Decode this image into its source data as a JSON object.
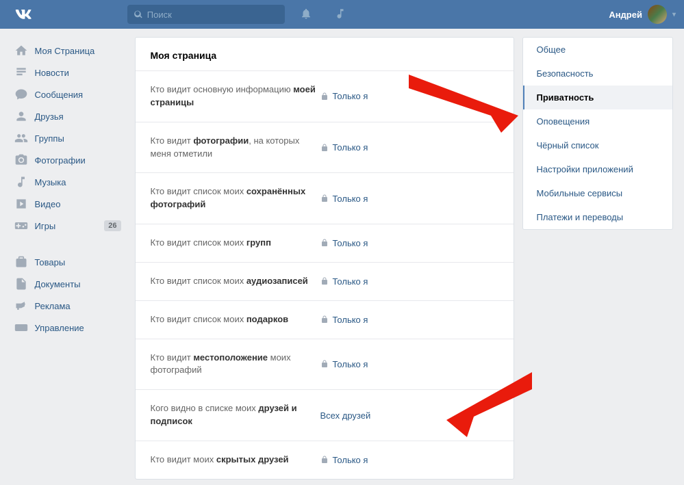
{
  "header": {
    "search_placeholder": "Поиск",
    "user_name": "Андрей"
  },
  "sidebar": {
    "items": [
      {
        "label": "Моя Страница"
      },
      {
        "label": "Новости"
      },
      {
        "label": "Сообщения"
      },
      {
        "label": "Друзья"
      },
      {
        "label": "Группы"
      },
      {
        "label": "Фотографии"
      },
      {
        "label": "Музыка"
      },
      {
        "label": "Видео"
      },
      {
        "label": "Игры",
        "badge": "26"
      }
    ],
    "items2": [
      {
        "label": "Товары"
      },
      {
        "label": "Документы"
      },
      {
        "label": "Реклама"
      },
      {
        "label": "Управление"
      }
    ]
  },
  "content": {
    "title": "Моя страница",
    "rows": [
      {
        "label_pre": "Кто видит основную информацию ",
        "label_bold": "моей страницы",
        "value": "Только я",
        "locked": true
      },
      {
        "label_pre": "Кто видит ",
        "label_bold": "фотографии",
        "label_post": ", на которых меня отметили",
        "value": "Только я",
        "locked": true
      },
      {
        "label_pre": "Кто видит список моих ",
        "label_bold": "сохранённых фотографий",
        "value": "Только я",
        "locked": true
      },
      {
        "label_pre": "Кто видит список моих ",
        "label_bold": "групп",
        "value": "Только я",
        "locked": true
      },
      {
        "label_pre": "Кто видит список моих ",
        "label_bold": "аудиозаписей",
        "value": "Только я",
        "locked": true
      },
      {
        "label_pre": "Кто видит список моих ",
        "label_bold": "подарков",
        "value": "Только я",
        "locked": true
      },
      {
        "label_pre": "Кто видит ",
        "label_bold": "местоположение",
        "label_post": " моих фотографий",
        "value": "Только я",
        "locked": true
      },
      {
        "label_pre": "Кого видно в списке моих ",
        "label_bold": "друзей и подписок",
        "value": "Всех друзей",
        "locked": false
      },
      {
        "label_pre": "Кто видит моих ",
        "label_bold": "скрытых друзей",
        "value": "Только я",
        "locked": true
      }
    ]
  },
  "rightnav": {
    "items": [
      {
        "label": "Общее"
      },
      {
        "label": "Безопасность"
      },
      {
        "label": "Приватность",
        "active": true
      },
      {
        "label": "Оповещения"
      },
      {
        "label": "Чёрный список"
      },
      {
        "label": "Настройки приложений"
      },
      {
        "label": "Мобильные сервисы"
      },
      {
        "label": "Платежи и переводы"
      }
    ]
  }
}
